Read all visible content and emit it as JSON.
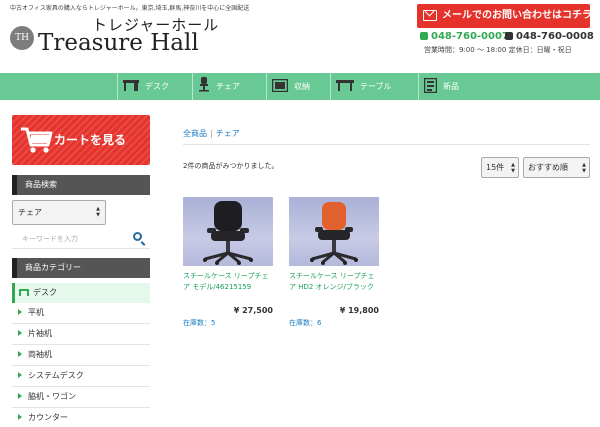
{
  "header": {
    "tagline": "中古オフィス家具の購入ならトレジャーホール。東京,埼玉,群馬,神奈川を中心に全国配送",
    "logo_badge": "TH",
    "logo_kana": "トレジャーホール",
    "logo_main": "Treasure Hall",
    "contact_label": "メールでのお問い合わせはコチラ",
    "tel1": "048-760-0007",
    "tel2": "048-760-0008",
    "hours": "営業時間：9:00 〜 18:00 定休日：日曜・祝日"
  },
  "nav": {
    "items": [
      "デスク",
      "チェア",
      "収納",
      "テーブル",
      "新品"
    ]
  },
  "sidebar": {
    "cart_label": "カートを見る",
    "search_heading": "商品検索",
    "search_select_value": "チェア",
    "keyword_placeholder": "キーワードを入力",
    "category_heading": "商品カテゴリー",
    "categories": [
      "デスク",
      "平机",
      "片袖机",
      "両袖机",
      "システムデスク",
      "脇机・ワゴン",
      "カウンター"
    ]
  },
  "main": {
    "breadcrumb": [
      "全商品",
      "チェア"
    ],
    "breadcrumb_sep": "|",
    "result_text": "2件の商品がみつかりました。",
    "per_page_value": "15件",
    "sort_value": "おすすめ順",
    "products": [
      {
        "title": "スチールケース リープチェア モデル/46215159",
        "price": "¥ 27,500",
        "stock": "在庫数：5"
      },
      {
        "title": "スチールケース リープチェア HD2 オレンジ/ブラック",
        "price": "¥ 19,800",
        "stock": "在庫数：6"
      }
    ]
  },
  "colors": {
    "accent_red": "#e5322b",
    "nav_green": "#69c994",
    "product_title_green": "#1aa05a",
    "link_blue": "#1c7cc2"
  },
  "icons": [
    "mail-icon",
    "phone-icon",
    "desk-icon",
    "chair-icon",
    "storage-icon",
    "table-icon",
    "new-icon",
    "cart-icon",
    "search-icon"
  ]
}
